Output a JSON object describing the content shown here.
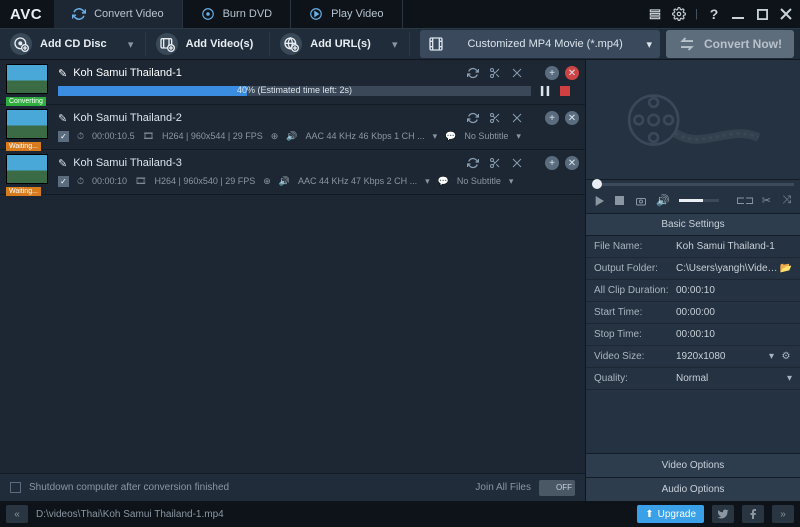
{
  "app": {
    "logo": "AVC"
  },
  "tabs": {
    "convert": "Convert Video",
    "burn": "Burn DVD",
    "play": "Play Video"
  },
  "toolbar": {
    "add_cd": "Add CD Disc",
    "add_videos": "Add Video(s)",
    "add_urls": "Add URL(s)",
    "profile": "Customized MP4 Movie (*.mp4)",
    "convert_now": "Convert Now!"
  },
  "files": [
    {
      "title": "Koh Samui Thailand-1",
      "status": "Converting",
      "progress_text": "40% (Estimated time left: 2s)"
    },
    {
      "title": "Koh Samui Thailand-2",
      "status": "Waiting...",
      "duration": "00:00:10.5",
      "video_spec": "H264 | 960x544 | 29 FPS",
      "audio_spec": "AAC 44 KHz 46 Kbps 1 CH ...",
      "subtitle": "No Subtitle"
    },
    {
      "title": "Koh Samui Thailand-3",
      "status": "Waiting...",
      "duration": "00:00:10",
      "video_spec": "H264 | 960x540 | 29 FPS",
      "audio_spec": "AAC 44 KHz 47 Kbps 2 CH ...",
      "subtitle": "No Subtitle"
    }
  ],
  "left_footer": {
    "shutdown": "Shutdown computer after conversion finished",
    "join": "Join All Files",
    "toggle_state": "OFF"
  },
  "settings": {
    "header": "Basic Settings",
    "rows": {
      "file_name_lbl": "File Name:",
      "file_name_val": "Koh Samui Thailand-1",
      "output_lbl": "Output Folder:",
      "output_val": "C:\\Users\\yangh\\Videos...",
      "clip_lbl": "All Clip Duration:",
      "clip_val": "00:00:10",
      "start_lbl": "Start Time:",
      "start_val": "00:00:00",
      "stop_lbl": "Stop Time:",
      "stop_val": "00:00:10",
      "size_lbl": "Video Size:",
      "size_val": "1920x1080",
      "quality_lbl": "Quality:",
      "quality_val": "Normal"
    },
    "video_options": "Video Options",
    "audio_options": "Audio Options"
  },
  "statusbar": {
    "path": "D:\\videos\\Thai\\Koh Samui Thailand-1.mp4",
    "upgrade": "Upgrade"
  }
}
